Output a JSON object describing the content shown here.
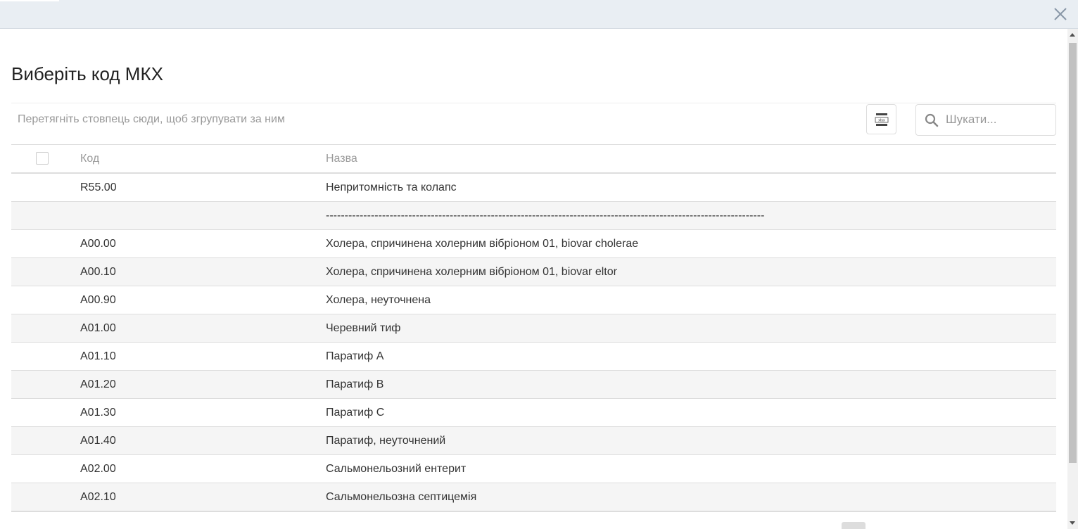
{
  "dialog": {
    "title": "Виберіть код МКХ"
  },
  "toolbar": {
    "group_panel_text": "Перетягніть стовпець сюди, щоб згрупувати за ним",
    "export_icon": "xlsx-export-icon",
    "search_placeholder": "Шукати..."
  },
  "grid": {
    "columns": [
      "Код",
      "Назва"
    ],
    "rows": [
      {
        "code": "R55.00",
        "name": "Непритомність та колапс"
      },
      {
        "code": "",
        "name": "---------------------------------------------------------------------------------------------------------------------"
      },
      {
        "code": "A00.00",
        "name": "Холера, спричинена холерним вібріоном 01, biovar cholerae"
      },
      {
        "code": "A00.10",
        "name": "Холера, спричинена холерним вібріоном 01, biovar eltor"
      },
      {
        "code": "A00.90",
        "name": "Холера, неуточнена"
      },
      {
        "code": "A01.00",
        "name": "Черевний тиф"
      },
      {
        "code": "A01.10",
        "name": "Паратиф А"
      },
      {
        "code": "A01.20",
        "name": "Паратиф В"
      },
      {
        "code": "A01.30",
        "name": "Паратиф С"
      },
      {
        "code": "A01.40",
        "name": "Паратиф, неуточнений"
      },
      {
        "code": "A02.00",
        "name": "Сальмонельозний ентерит"
      },
      {
        "code": "A02.10",
        "name": "Сальмонельозна септицемія"
      }
    ]
  },
  "colors": {
    "topbar": "#e9eef3",
    "alt_row": "#f5f5f5",
    "muted_text": "#999999"
  }
}
